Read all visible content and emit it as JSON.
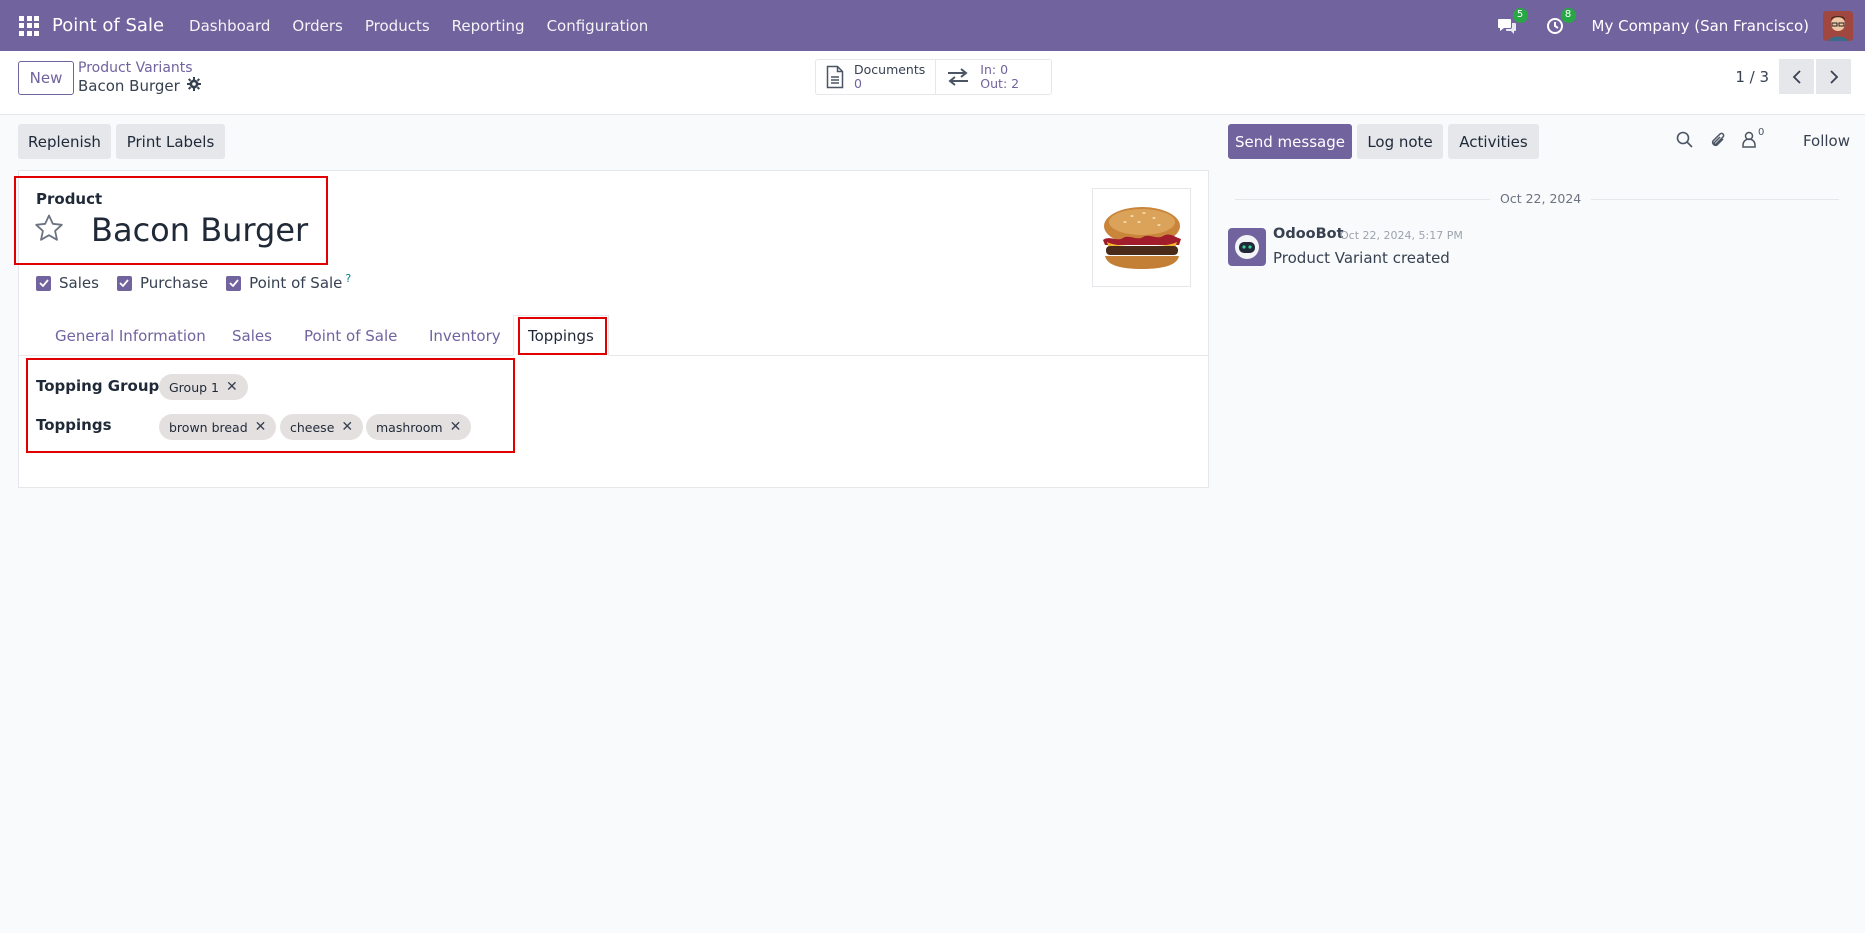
{
  "navbar": {
    "brand": "Point of Sale",
    "menu": [
      "Dashboard",
      "Orders",
      "Products",
      "Reporting",
      "Configuration"
    ],
    "messages_count": "5",
    "activities_count": "8",
    "company": "My Company (San Francisco)"
  },
  "control": {
    "new_label": "New",
    "breadcrumb_parent": "Product Variants",
    "breadcrumb_current": "Bacon Burger",
    "documents_label": "Documents",
    "documents_count": "0",
    "moves_in": "In: 0",
    "moves_out": "Out: 2",
    "pager": "1 / 3"
  },
  "actions": {
    "replenish": "Replenish",
    "print_labels": "Print Labels"
  },
  "form": {
    "product_label": "Product",
    "product_name": "Bacon Burger",
    "checkboxes": [
      {
        "label": "Sales",
        "checked": true
      },
      {
        "label": "Purchase",
        "checked": true
      },
      {
        "label": "Point of Sale",
        "checked": true
      }
    ],
    "help_mark": "?",
    "tabs": [
      "General Information",
      "Sales",
      "Point of Sale",
      "Inventory",
      "Toppings"
    ],
    "active_tab": "Toppings",
    "topping_group_label": "Topping Group",
    "topping_group_tags": [
      "Group 1"
    ],
    "toppings_label": "Toppings",
    "toppings_tags": [
      "brown bread",
      "cheese",
      "mashroom"
    ]
  },
  "chatter": {
    "send_message": "Send message",
    "log_note": "Log note",
    "activities": "Activities",
    "followers_count": "0",
    "follow": "Follow",
    "date_separator": "Oct 22, 2024",
    "message": {
      "author": "OdooBot",
      "time": "Oct 22, 2024, 5:17 PM",
      "body": "Product Variant created"
    }
  },
  "icons": {
    "apps": "apps-grid-icon",
    "messages": "chat-bubbles-icon",
    "activities": "clock-icon",
    "settings": "gear-icon",
    "favorite": "star-icon",
    "documents": "file-icon",
    "moves": "arrows-exchange-icon",
    "search": "search-icon",
    "attachment": "paperclip-icon",
    "followers": "user-icon"
  },
  "colors": {
    "brand": "#71639e",
    "highlight_border": "#e00000",
    "badge": "#28a745"
  }
}
